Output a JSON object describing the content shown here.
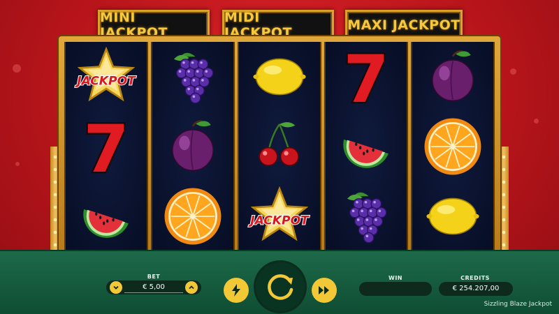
{
  "jackpots": {
    "mini": "MINI JACKPOT",
    "midi": "MIDI JACKPOT",
    "maxi": "MAXI JACKPOT"
  },
  "reels": [
    [
      "jackpot",
      "seven",
      "watermelon"
    ],
    [
      "grapes",
      "plum",
      "orange"
    ],
    [
      "lemon",
      "cherries",
      "jackpot"
    ],
    [
      "seven",
      "watermelon",
      "grapes"
    ],
    [
      "plum",
      "orange",
      "lemon"
    ]
  ],
  "symbol_text": {
    "jackpot": "JACKPOT",
    "seven": "7"
  },
  "controls": {
    "bet_label": "BET",
    "bet_value": "€ 5,00",
    "win_label": "WIN",
    "win_value": "",
    "credits_label": "CREDITS",
    "credits_value": "€ 254.207,00",
    "turbo_icon": "lightning-icon",
    "spin_icon": "spin-arrow-icon",
    "autoplay_icon": "fast-forward-icon"
  },
  "game_title": "Sizzling Blaze Jackpot",
  "colors": {
    "background_red": "#c8191f",
    "table_green": "#17603f",
    "gold": "#f3c836",
    "reel_navy": "#0b1433"
  }
}
